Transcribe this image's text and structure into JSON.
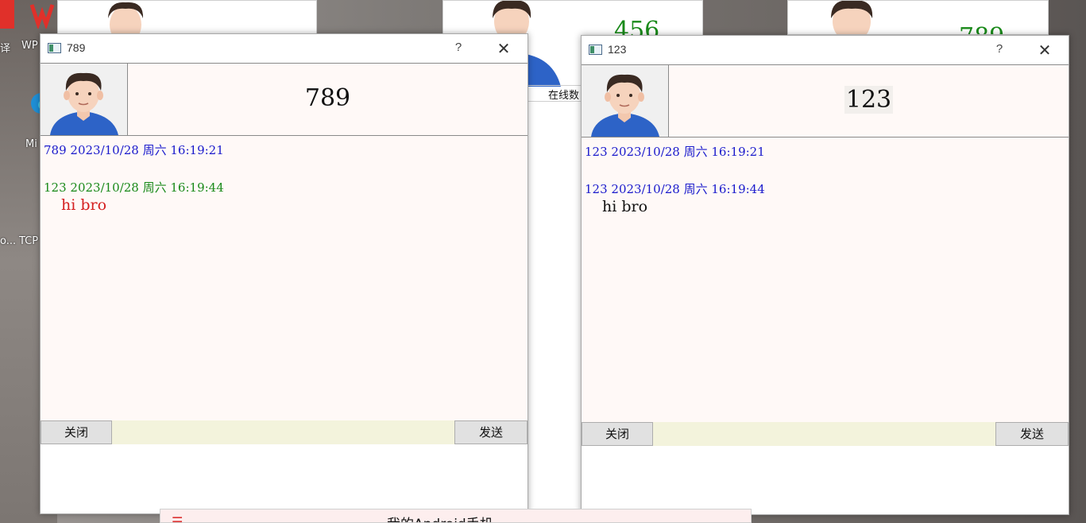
{
  "desktop": {
    "label_1": "译",
    "label_2": "WP",
    "label_3": "Mi",
    "label_4": "o...",
    "label_5": "TCP"
  },
  "background_windows": [
    {
      "name": "456",
      "status_label": "在线数"
    },
    {
      "name": "789"
    }
  ],
  "window_left": {
    "title": "789",
    "help": "?",
    "close": "✕",
    "header_name": "789",
    "messages": [
      {
        "meta": "789 2023/10/28 周六 16:19:21",
        "meta_color": "#1a1acc",
        "body": "",
        "body_color": "#cc1a1a"
      },
      {
        "meta": "123 2023/10/28 周六 16:19:44",
        "meta_color": "#1a8a1a",
        "body": "hi bro",
        "body_color": "#d42020"
      }
    ],
    "close_button": "关闭",
    "send_button": "发送",
    "input_value": ""
  },
  "window_right": {
    "title": "123",
    "help": "?",
    "close": "✕",
    "header_name": "123",
    "messages": [
      {
        "meta": "123 2023/10/28 周六 16:19:21",
        "meta_color": "#1a1acc",
        "body": ""
      },
      {
        "meta": "123 2023/10/28 周六 16:19:44",
        "meta_color": "#1a1acc",
        "body": "hi bro",
        "body_color": "#111111"
      }
    ],
    "close_button": "关闭",
    "send_button": "发送",
    "input_value": ""
  },
  "taskbar_peek": {
    "text": "我的Android手机"
  }
}
